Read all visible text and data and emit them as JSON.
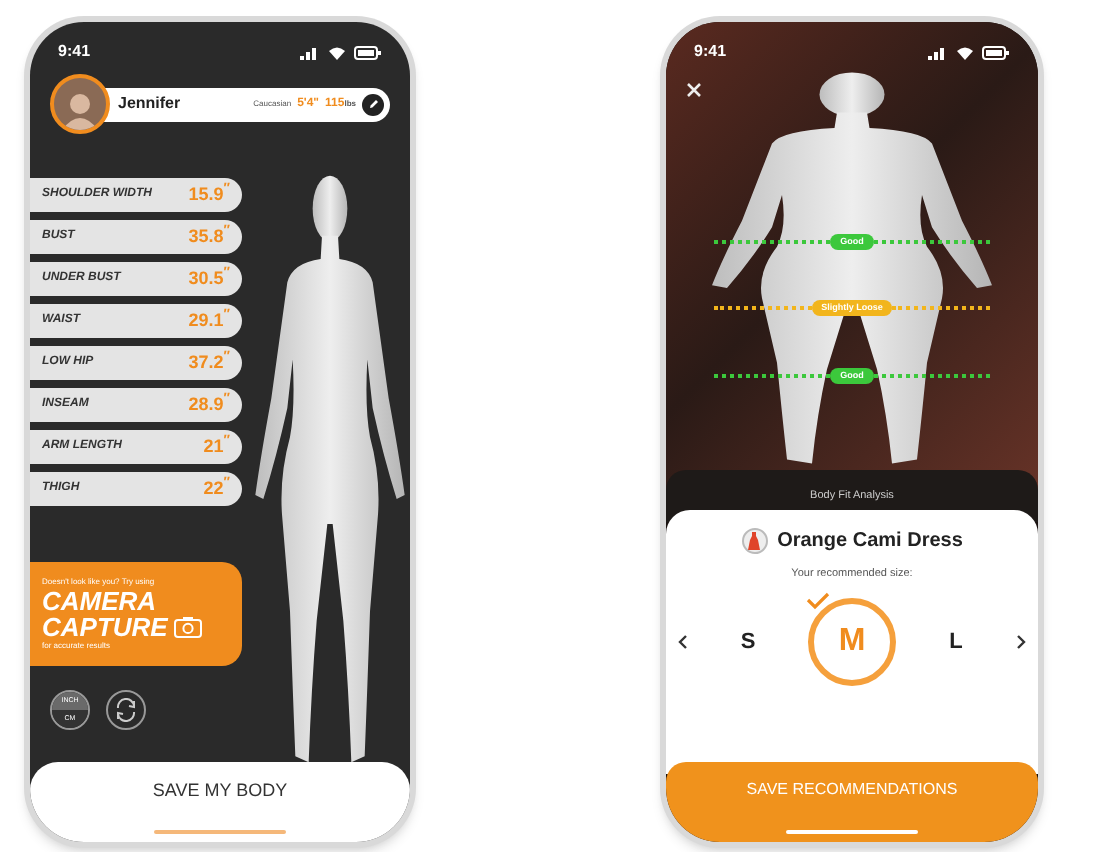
{
  "left_screen": {
    "status_bar": {
      "time": "9:41"
    },
    "profile": {
      "name": "Jennifer",
      "ethnicity": "Caucasian",
      "height": "5'4\"",
      "weight": "115",
      "weight_unit": "lbs"
    },
    "measurements": [
      {
        "label": "SHOULDER WIDTH",
        "value": "15.9$^{″}$"
      },
      {
        "label": "BUST",
        "value": "35.8$^{″}$"
      },
      {
        "label": "UNDER BUST",
        "value": "30.5$^{″}$"
      },
      {
        "label": "WAIST",
        "value": "29.1$^{″}$"
      },
      {
        "label": "LOW HIP",
        "value": "37.2$^{″}$"
      },
      {
        "label": "INSEAM",
        "value": "28.9$^{″}$"
      },
      {
        "label": "ARM LENGTH",
        "value": "21$^{″}$"
      },
      {
        "label": "THIGH",
        "value": "22$^{″}$"
      }
    ],
    "camera_card": {
      "prompt": "Doesn't look like you? Try using",
      "title_line_1": "CAMERA",
      "title_line_2": "CAPTURE",
      "note": "for accurate results"
    },
    "unit_toggle": [
      {
        "label": "INCH",
        "selected": true
      },
      {
        "label": "CM",
        "selected": false
      }
    ],
    "save_button": "SAVE MY BODY"
  },
  "right_screen": {
    "status_bar": {
      "time": "9:41"
    },
    "fit_tags": [
      {
        "label": "Good",
        "color": "#3cc83c"
      },
      {
        "label": "Slightly Loose",
        "color": "#f2b51c"
      },
      {
        "label": "Good",
        "color": "#3cc83c"
      }
    ],
    "section_label": "Body Fit Analysis",
    "product": {
      "name": "Orange Cami Dress"
    },
    "recommendation_label": "Your recommended size:",
    "sizes": [
      {
        "label": "S",
        "selected": false
      },
      {
        "label": "M",
        "selected": true
      },
      {
        "label": "L",
        "selected": false
      }
    ],
    "save_button": "SAVE RECOMMENDATIONS"
  }
}
